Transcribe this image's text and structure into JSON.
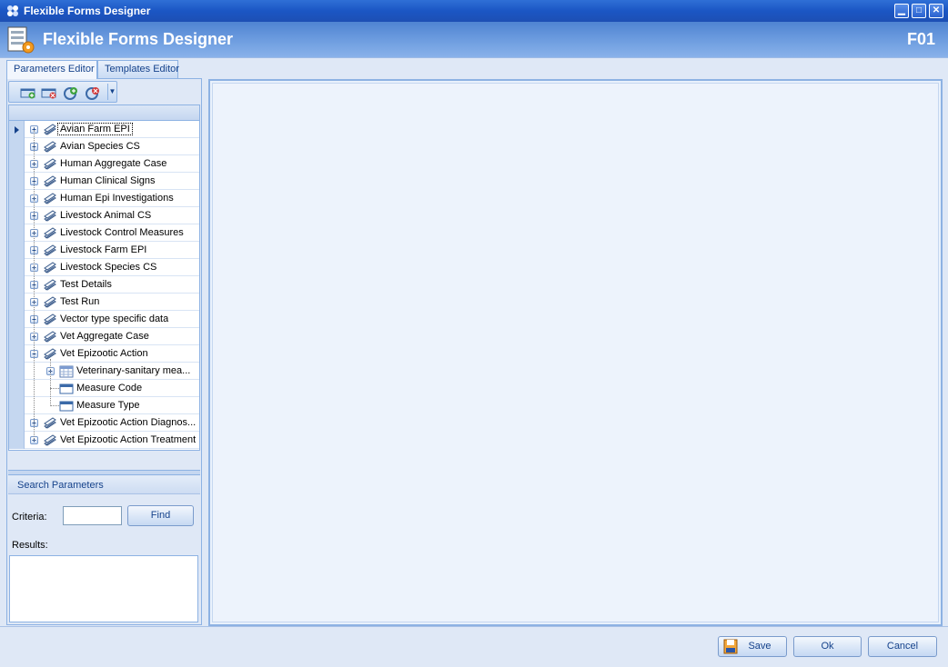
{
  "window": {
    "title": "Flexible Forms Designer",
    "controls": [
      "minimize",
      "maximize",
      "close"
    ]
  },
  "header": {
    "title": "Flexible Forms Designer",
    "code": "F01"
  },
  "tabs": [
    {
      "label": "Parameters Editor",
      "active": true
    },
    {
      "label": "Templates Editor",
      "active": false
    }
  ],
  "toolbar": {
    "buttons": [
      "add-section-icon",
      "remove-section-icon",
      "add-parameter-icon",
      "remove-parameter-icon"
    ]
  },
  "tree": [
    {
      "label": "Avian Farm EPI",
      "level": 0,
      "expanded": false,
      "selected": true,
      "icon": "section-icon"
    },
    {
      "label": "Avian Species CS",
      "level": 0,
      "expanded": false,
      "icon": "section-icon"
    },
    {
      "label": "Human Aggregate Case",
      "level": 0,
      "expanded": false,
      "icon": "section-icon"
    },
    {
      "label": "Human Clinical Signs",
      "level": 0,
      "expanded": false,
      "icon": "section-icon"
    },
    {
      "label": "Human Epi Investigations",
      "level": 0,
      "expanded": false,
      "icon": "section-icon"
    },
    {
      "label": "Livestock Animal CS",
      "level": 0,
      "expanded": false,
      "icon": "section-icon"
    },
    {
      "label": "Livestock Control Measures",
      "level": 0,
      "expanded": false,
      "icon": "section-icon"
    },
    {
      "label": "Livestock Farm EPI",
      "level": 0,
      "expanded": false,
      "icon": "section-icon"
    },
    {
      "label": "Livestock Species CS",
      "level": 0,
      "expanded": false,
      "icon": "section-icon"
    },
    {
      "label": "Test Details",
      "level": 0,
      "expanded": false,
      "icon": "section-icon"
    },
    {
      "label": "Test Run",
      "level": 0,
      "expanded": false,
      "icon": "section-icon"
    },
    {
      "label": "Vector type specific data",
      "level": 0,
      "expanded": false,
      "icon": "section-icon"
    },
    {
      "label": "Vet Aggregate Case",
      "level": 0,
      "expanded": false,
      "icon": "section-icon"
    },
    {
      "label": "Vet Epizootic Action",
      "level": 0,
      "expanded": true,
      "icon": "section-icon"
    },
    {
      "label": "Veterinary-sanitary mea...",
      "level": 1,
      "expanded": false,
      "icon": "table-icon"
    },
    {
      "label": "Measure Code",
      "level": 1,
      "leaf": true,
      "icon": "field-icon"
    },
    {
      "label": "Measure Type",
      "level": 1,
      "leaf": true,
      "icon": "field-icon"
    },
    {
      "label": "Vet Epizootic Action Diagnos...",
      "level": 0,
      "expanded": false,
      "icon": "section-icon"
    },
    {
      "label": "Vet Epizootic Action Treatment",
      "level": 0,
      "expanded": false,
      "icon": "section-icon"
    }
  ],
  "search": {
    "header": "Search Parameters",
    "criteria_label": "Criteria:",
    "criteria_value": "",
    "find_label": "Find",
    "results_label": "Results:"
  },
  "footer": {
    "save_label": "Save",
    "ok_label": "Ok",
    "cancel_label": "Cancel"
  },
  "colors": {
    "titlebar": "#1b56c4",
    "header": "#6f9ee0",
    "panel_bg": "#dfe8f6",
    "border": "#8db2e3",
    "label_text": "#15428b"
  }
}
